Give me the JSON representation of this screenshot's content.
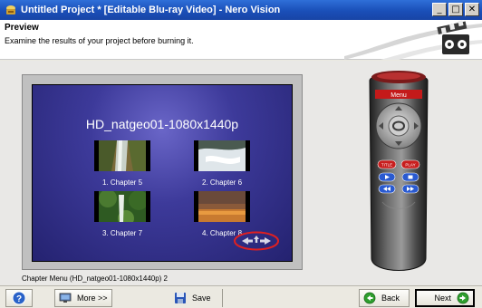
{
  "window": {
    "title": "Untitled Project * [Editable Blu-ray Video] - Nero Vision",
    "minimize_glyph": "_",
    "maximize_glyph": "□",
    "close_glyph": "✕"
  },
  "header": {
    "title": "Preview",
    "subtitle": "Examine the results of your project before burning it."
  },
  "preview": {
    "menu_title": "HD_natgeo01-1080x1440p",
    "chapters": [
      {
        "label": "1. Chapter 5",
        "icon": "waterfall-canyon-thumbnail"
      },
      {
        "label": "2. Chapter 6",
        "icon": "waterfall-rapids-thumbnail"
      },
      {
        "label": "3. Chapter 7",
        "icon": "jungle-waterfall-thumbnail"
      },
      {
        "label": "4. Chapter 8",
        "icon": "sunset-lake-thumbnail"
      }
    ],
    "nav_icon": "menu-navigation-arrows-icon"
  },
  "remote": {
    "menu_label": "Menu",
    "title_label": "TITLE",
    "play_label": "PLAY"
  },
  "status": {
    "text": "Chapter Menu (HD_natgeo01-1080x1440p) 2"
  },
  "bottom": {
    "help_icon": "help-icon",
    "more_label": "More >>",
    "save_label": "Save",
    "back_label": "Back",
    "next_label": "Next"
  },
  "colors": {
    "titlebar": "#1a4fb8",
    "screen": "#3d3a9a",
    "highlight_ring": "#e02020",
    "back_next_green": "#2e9e2e"
  }
}
